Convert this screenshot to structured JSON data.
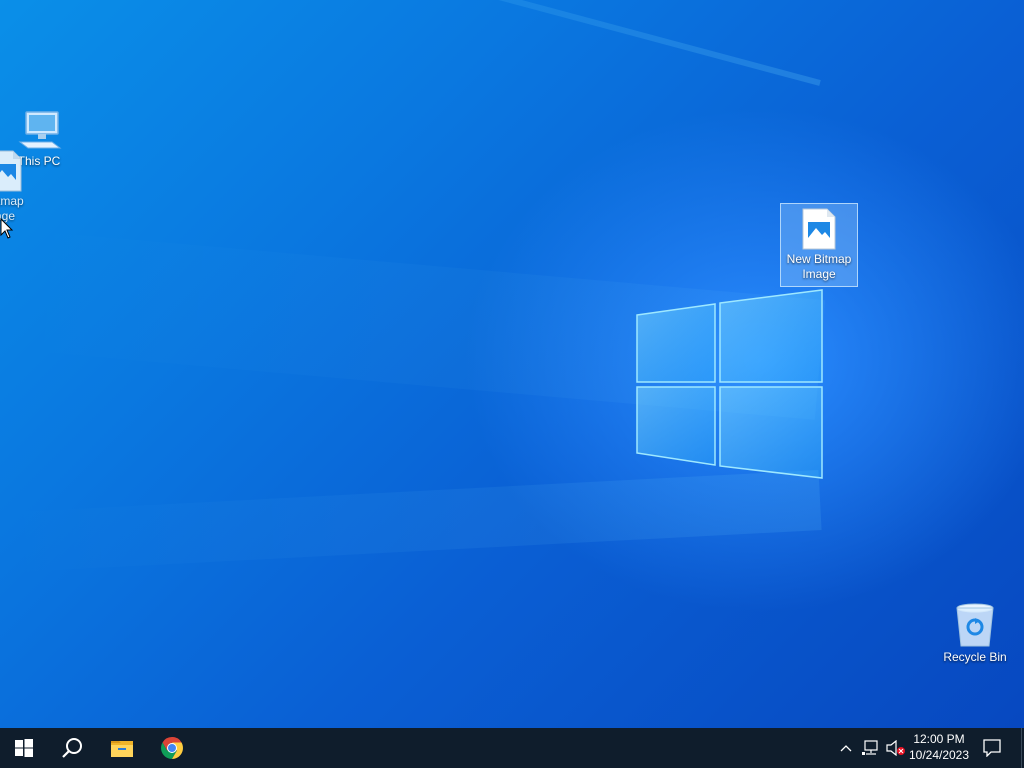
{
  "desktop": {
    "icons": [
      {
        "label": "This PC",
        "icon": "this-pc-icon"
      },
      {
        "label": "Bitmap\nage",
        "icon": "bitmap-image-icon"
      },
      {
        "label": "New Bitmap\nImage",
        "icon": "bitmap-image-icon"
      },
      {
        "label": "Recycle Bin",
        "icon": "recycle-bin-icon"
      }
    ]
  },
  "taskbar": {
    "start_icon": "windows-start-icon",
    "search_icon": "search-icon",
    "pinned": [
      {
        "name": "File Explorer",
        "icon": "folder-icon"
      },
      {
        "name": "Google Chrome",
        "icon": "chrome-icon"
      }
    ],
    "tray": {
      "chevron_icon": "chevron-up-icon",
      "network_icon": "network-icon",
      "volume_icon": "volume-muted-icon",
      "notification_icon": "notification-icon"
    },
    "clock": {
      "time": "12:00 PM",
      "date": "10/24/2023"
    }
  },
  "colors": {
    "wallpaper": "#0a78e0",
    "taskbar": "#0f1d2c",
    "selection": "#a0d2ff"
  }
}
